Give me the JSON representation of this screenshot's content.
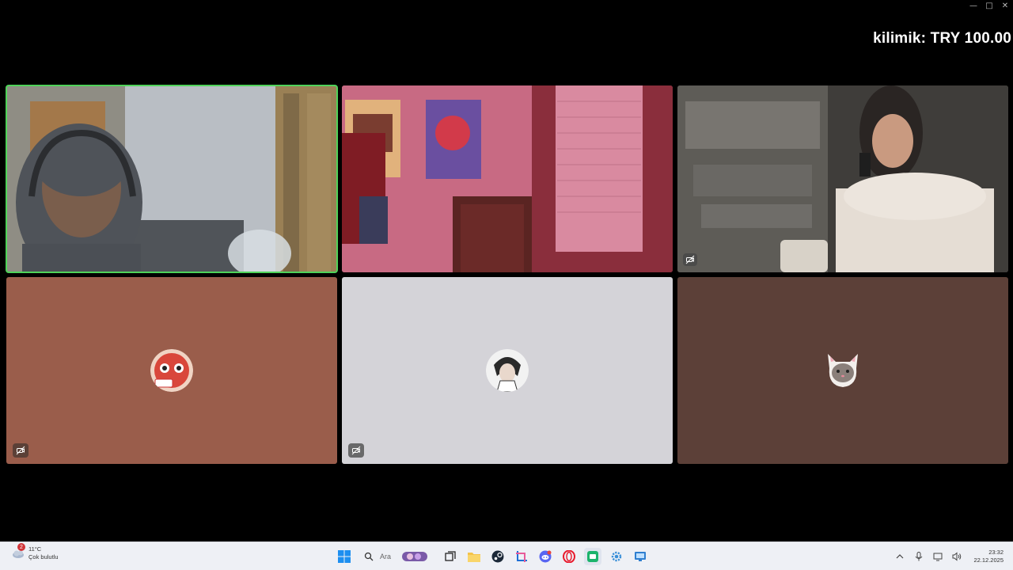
{
  "overlay": {
    "text": "kilimik: TRY 100.00"
  },
  "window_controls": {
    "minimize": "—",
    "maximize": "□",
    "close": "✕"
  },
  "tiles": [
    {
      "id": "cam-1",
      "kind": "camera",
      "active": true
    },
    {
      "id": "cam-2",
      "kind": "camera",
      "active": false
    },
    {
      "id": "cam-3",
      "kind": "camera",
      "active": false,
      "muted": true
    },
    {
      "id": "avatar-1",
      "kind": "avatar",
      "bg": "#9a5d4b",
      "muted": true
    },
    {
      "id": "avatar-2",
      "kind": "avatar",
      "bg": "#d4d3d8",
      "muted": true
    },
    {
      "id": "avatar-3",
      "kind": "avatar",
      "bg": "#5c4038",
      "muted": false
    }
  ],
  "colors": {
    "active_border": "#4fd35a"
  },
  "taskbar": {
    "weather": {
      "temp": "11°C",
      "desc": "Çok bulutlu",
      "badge": "2"
    },
    "search_placeholder": "Ara",
    "apps": [
      "windows-start",
      "search",
      "game-widget",
      "task-view",
      "file-explorer",
      "steam",
      "snipping-tool",
      "discord",
      "opera",
      "active-app",
      "settings-app",
      "remote-desktop"
    ],
    "clock": {
      "time": "23:32",
      "date": "22.12.2025"
    }
  }
}
